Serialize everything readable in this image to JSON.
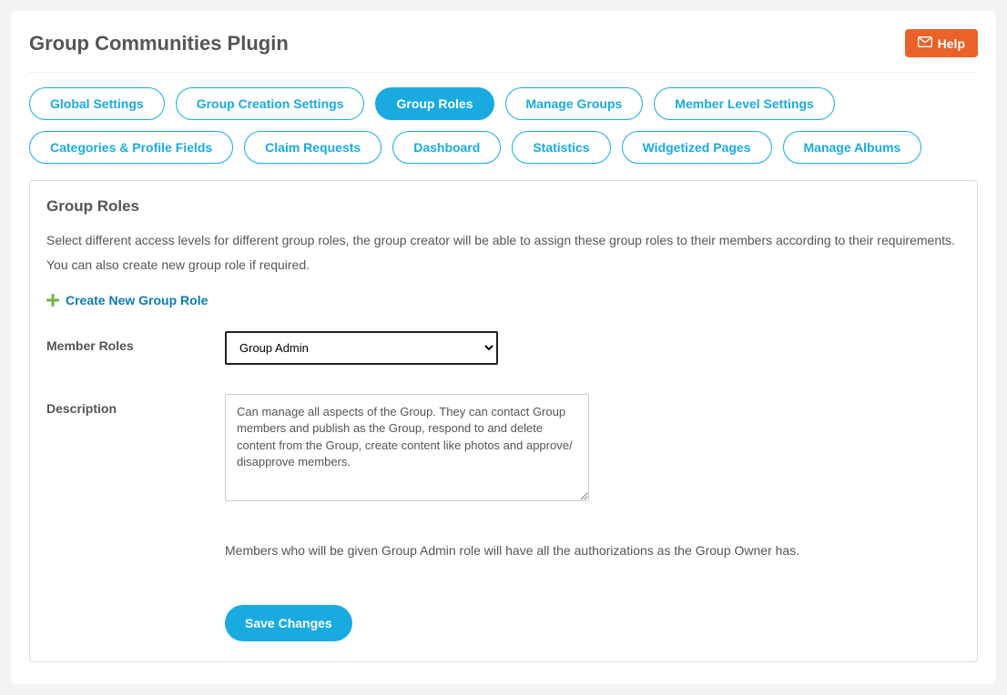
{
  "header": {
    "title": "Group Communities Plugin",
    "help_label": "Help"
  },
  "tabs": [
    {
      "label": "Global Settings",
      "active": false
    },
    {
      "label": "Group Creation Settings",
      "active": false
    },
    {
      "label": "Group Roles",
      "active": true
    },
    {
      "label": "Manage Groups",
      "active": false
    },
    {
      "label": "Member Level Settings",
      "active": false
    },
    {
      "label": "Categories & Profile Fields",
      "active": false
    },
    {
      "label": "Claim Requests",
      "active": false
    },
    {
      "label": "Dashboard",
      "active": false
    },
    {
      "label": "Statistics",
      "active": false
    },
    {
      "label": "Widgetized Pages",
      "active": false
    },
    {
      "label": "Manage Albums",
      "active": false
    }
  ],
  "panel": {
    "title": "Group Roles",
    "description": "Select different access levels for different group roles, the group creator will be able to assign these group roles to their members according to their requirements. You can also create new group role if required.",
    "create_link": "Create New Group Role",
    "form": {
      "member_roles_label": "Member Roles",
      "member_roles_value": "Group Admin",
      "description_label": "Description",
      "description_value": "Can manage all aspects of the Group. They can contact Group members and publish as the Group, respond to and delete content from the Group, create content like photos and approve/ disapprove members.",
      "note": "Members who will be given Group Admin role will have all the authorizations as the Group Owner has.",
      "save_label": "Save Changes"
    }
  },
  "colors": {
    "accent": "#19abe0",
    "help_btn": "#e8622a",
    "link": "#0e7bb0"
  }
}
